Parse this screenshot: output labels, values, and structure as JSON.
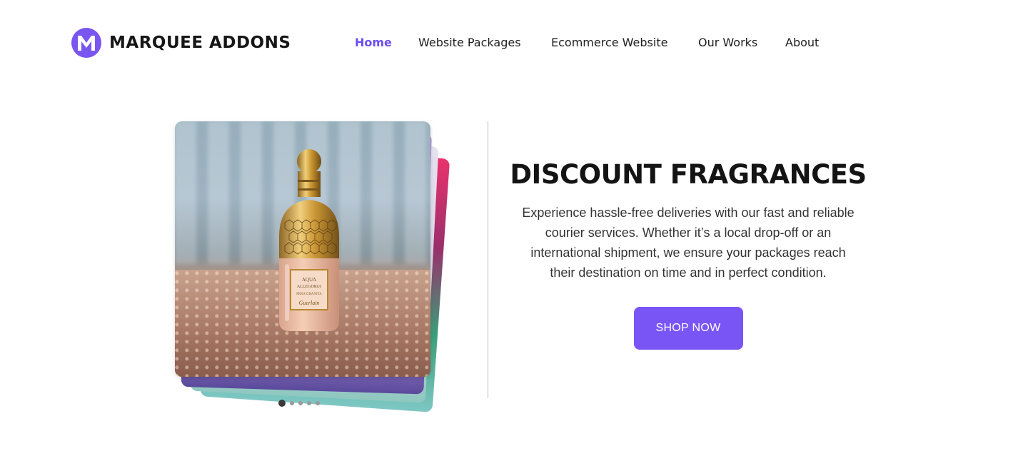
{
  "brand": {
    "name": "MARQUEE ADDONS",
    "logo_letter": "M",
    "accent_color": "#7a55f0"
  },
  "nav": {
    "items": [
      {
        "label": "Home",
        "active": true
      },
      {
        "label": "Website Packages",
        "active": false
      },
      {
        "label": "Ecommerce Website",
        "active": false
      },
      {
        "label": "Our Works",
        "active": false
      },
      {
        "label": "About",
        "active": false
      }
    ],
    "active_color": "#6c4ef2"
  },
  "slider": {
    "image_subject": "perfume bottle on sequined fabric",
    "bottle_label": {
      "line1": "AQUA",
      "line2": "ALLEGORIA",
      "line3": "PERA GRANITA",
      "signature": "Guerlain"
    },
    "slide_count": 5,
    "active_index": 0
  },
  "hero": {
    "title": "DISCOUNT FRAGRANCES",
    "description": "Experience hassle-free deliveries with our fast and reliable courier services. Whether it’s a local drop-off or an international shipment, we ensure your packages reach their destination on time and in perfect condition.",
    "cta_label": "SHOP NOW",
    "cta_color": "#7a55f5"
  }
}
